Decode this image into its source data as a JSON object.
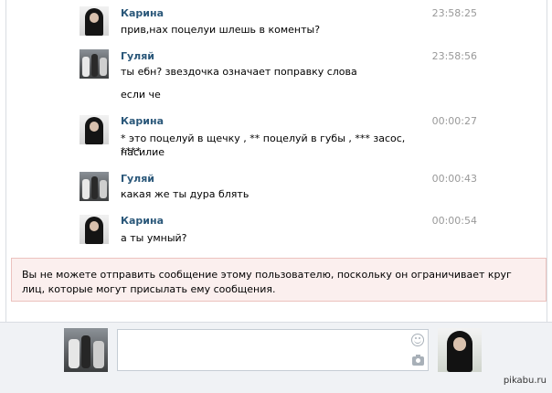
{
  "messages": [
    {
      "author": "Карина",
      "time": "23:58:25",
      "lines": [
        "прив,нах поцелуи шлешь в коменты?"
      ]
    },
    {
      "author": "Гуляй",
      "time": "23:58:56",
      "lines": [
        "ты ебн? звездочка означает поправку слова",
        "если че"
      ]
    },
    {
      "author": "Карина",
      "time": "00:00:27",
      "lines": [
        "* это поцелуй в щечку , ** поцелуй в губы , *** засос, ****",
        "насилие"
      ]
    },
    {
      "author": "Гуляй",
      "time": "00:00:43",
      "lines": [
        "какая же ты дура блять"
      ]
    },
    {
      "author": "Карина",
      "time": "00:00:54",
      "lines": [
        "а ты умный?"
      ]
    }
  ],
  "notice": "Вы не можете отправить сообщение этому пользователю, поскольку он ограничивает круг лиц, которые могут присылать ему сообщения.",
  "composer": {
    "value": "",
    "placeholder": ""
  },
  "watermark": "pikabu.ru",
  "icons": {
    "emoji": "smile-icon",
    "attach": "camera-icon"
  },
  "colors": {
    "author": "#2b587a",
    "time": "#999999",
    "notice_bg": "#fbefee",
    "notice_border": "#ecc2be"
  }
}
